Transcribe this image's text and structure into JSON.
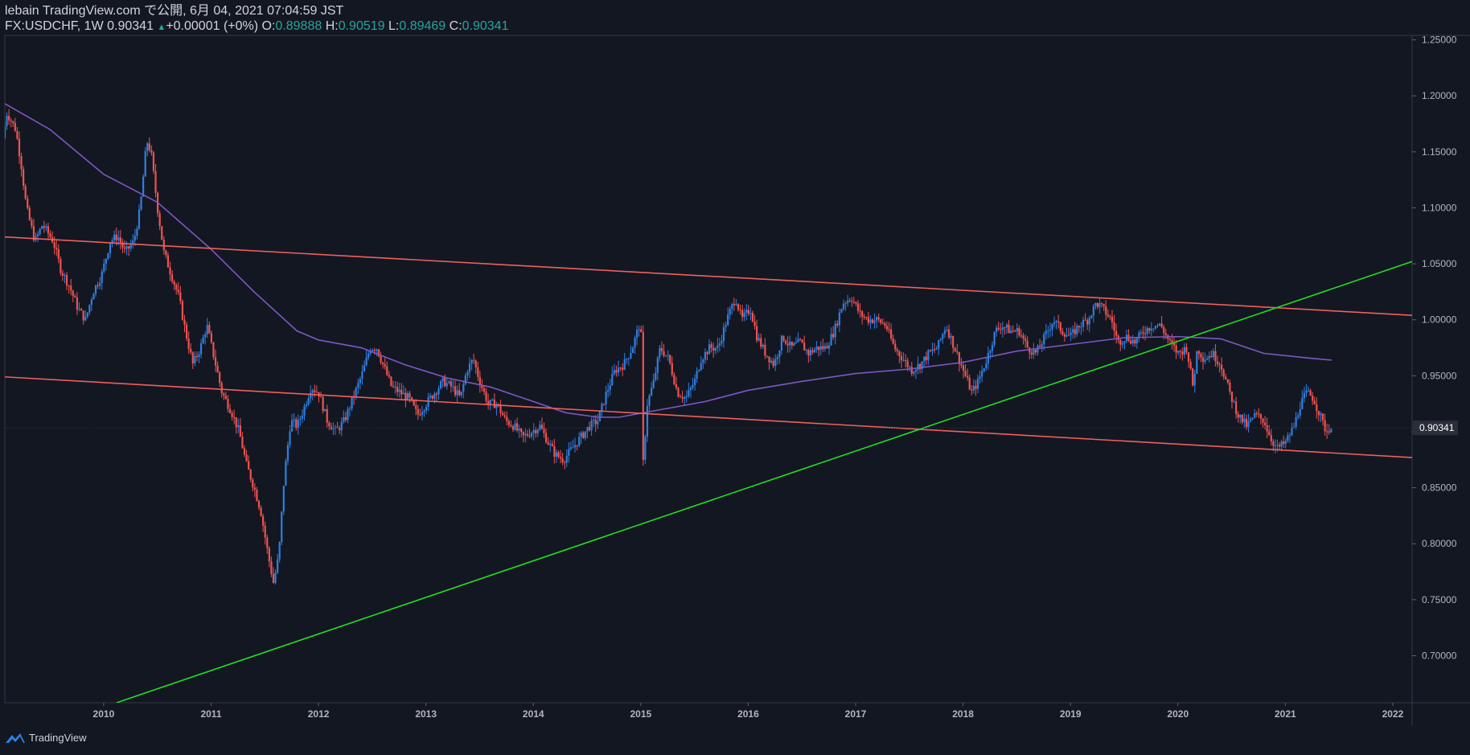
{
  "header": {
    "publish_line": "lebain TradingView.com で公開, 6月 04, 2021 07:04:59 JST",
    "symbol": "FX:USDCHF, 1W",
    "last": "0.90341",
    "change_arrow": "▲",
    "change": "+0.00001 (+0%)",
    "o_label": "O:",
    "o_value": "0.89888",
    "h_label": "H:",
    "h_value": "0.90519",
    "l_label": "L:",
    "l_value": "0.89469",
    "c_label": "C:",
    "c_value": "0.90341"
  },
  "footer": {
    "brand": "TradingView",
    "logo_icon": "tradingview-logo-icon"
  },
  "colors": {
    "background": "#131722",
    "up": "#2f7fe0",
    "down": "#ef5350",
    "channel": "#f0605a",
    "trendline": "#22dd22",
    "ma": "#7e57c2",
    "axis_text": "#b2b5be"
  },
  "chart_data": {
    "type": "candlestick",
    "symbol": "FX:USDCHF",
    "interval": "1W",
    "x_ticks": [
      "2010",
      "2011",
      "2012",
      "2013",
      "2014",
      "2015",
      "2016",
      "2017",
      "2018",
      "2019",
      "2020",
      "2021",
      "2022"
    ],
    "x_range": [
      2009.08,
      2022.18
    ],
    "y_ticks": [
      "1.25000",
      "1.20000",
      "1.15000",
      "1.10000",
      "1.05000",
      "1.00000",
      "0.95000",
      "0.90000",
      "0.85000",
      "0.80000",
      "0.75000",
      "0.70000"
    ],
    "y_range": [
      0.658,
      1.254
    ],
    "last_price_label": "0.90341",
    "last_price": 0.90341,
    "price_path": [
      [
        2009.08,
        1.162
      ],
      [
        2009.12,
        1.185
      ],
      [
        2009.2,
        1.17
      ],
      [
        2009.25,
        1.14
      ],
      [
        2009.3,
        1.1
      ],
      [
        2009.38,
        1.07
      ],
      [
        2009.45,
        1.085
      ],
      [
        2009.55,
        1.07
      ],
      [
        2009.62,
        1.045
      ],
      [
        2009.7,
        1.03
      ],
      [
        2009.78,
        1.01
      ],
      [
        2009.85,
        1.0
      ],
      [
        2009.92,
        1.025
      ],
      [
        2010.0,
        1.04
      ],
      [
        2010.08,
        1.07
      ],
      [
        2010.15,
        1.075
      ],
      [
        2010.22,
        1.06
      ],
      [
        2010.3,
        1.07
      ],
      [
        2010.36,
        1.1
      ],
      [
        2010.42,
        1.16
      ],
      [
        2010.46,
        1.15
      ],
      [
        2010.52,
        1.1
      ],
      [
        2010.58,
        1.06
      ],
      [
        2010.65,
        1.04
      ],
      [
        2010.72,
        1.02
      ],
      [
        2010.78,
        0.99
      ],
      [
        2010.85,
        0.96
      ],
      [
        2010.92,
        0.975
      ],
      [
        2010.98,
        0.995
      ],
      [
        2011.05,
        0.965
      ],
      [
        2011.12,
        0.935
      ],
      [
        2011.2,
        0.92
      ],
      [
        2011.28,
        0.9
      ],
      [
        2011.35,
        0.87
      ],
      [
        2011.42,
        0.85
      ],
      [
        2011.48,
        0.83
      ],
      [
        2011.55,
        0.79
      ],
      [
        2011.6,
        0.765
      ],
      [
        2011.65,
        0.79
      ],
      [
        2011.7,
        0.86
      ],
      [
        2011.76,
        0.91
      ],
      [
        2011.82,
        0.905
      ],
      [
        2011.88,
        0.92
      ],
      [
        2011.95,
        0.94
      ],
      [
        2012.02,
        0.935
      ],
      [
        2012.1,
        0.91
      ],
      [
        2012.18,
        0.9
      ],
      [
        2012.26,
        0.91
      ],
      [
        2012.34,
        0.93
      ],
      [
        2012.42,
        0.95
      ],
      [
        2012.5,
        0.975
      ],
      [
        2012.56,
        0.975
      ],
      [
        2012.62,
        0.96
      ],
      [
        2012.7,
        0.94
      ],
      [
        2012.78,
        0.935
      ],
      [
        2012.86,
        0.93
      ],
      [
        2012.94,
        0.915
      ],
      [
        2013.02,
        0.925
      ],
      [
        2013.1,
        0.935
      ],
      [
        2013.18,
        0.945
      ],
      [
        2013.26,
        0.94
      ],
      [
        2013.34,
        0.93
      ],
      [
        2013.4,
        0.955
      ],
      [
        2013.46,
        0.965
      ],
      [
        2013.52,
        0.945
      ],
      [
        2013.6,
        0.925
      ],
      [
        2013.68,
        0.925
      ],
      [
        2013.76,
        0.91
      ],
      [
        2013.84,
        0.905
      ],
      [
        2013.92,
        0.895
      ],
      [
        2014.0,
        0.9
      ],
      [
        2014.08,
        0.905
      ],
      [
        2014.16,
        0.89
      ],
      [
        2014.22,
        0.88
      ],
      [
        2014.3,
        0.875
      ],
      [
        2014.38,
        0.885
      ],
      [
        2014.46,
        0.895
      ],
      [
        2014.54,
        0.905
      ],
      [
        2014.62,
        0.91
      ],
      [
        2014.7,
        0.935
      ],
      [
        2014.78,
        0.955
      ],
      [
        2014.86,
        0.96
      ],
      [
        2014.94,
        0.975
      ],
      [
        2015.02,
        1.0
      ],
      [
        2015.04,
        0.87
      ],
      [
        2015.08,
        0.925
      ],
      [
        2015.14,
        0.945
      ],
      [
        2015.2,
        0.975
      ],
      [
        2015.28,
        0.965
      ],
      [
        2015.36,
        0.935
      ],
      [
        2015.44,
        0.93
      ],
      [
        2015.52,
        0.945
      ],
      [
        2015.58,
        0.965
      ],
      [
        2015.66,
        0.975
      ],
      [
        2015.74,
        0.975
      ],
      [
        2015.82,
        1.0
      ],
      [
        2015.9,
        1.02
      ],
      [
        2015.96,
        1.0
      ],
      [
        2016.04,
        1.01
      ],
      [
        2016.1,
        0.985
      ],
      [
        2016.18,
        0.97
      ],
      [
        2016.26,
        0.96
      ],
      [
        2016.34,
        0.985
      ],
      [
        2016.42,
        0.975
      ],
      [
        2016.5,
        0.98
      ],
      [
        2016.58,
        0.97
      ],
      [
        2016.66,
        0.975
      ],
      [
        2016.74,
        0.975
      ],
      [
        2016.82,
        0.99
      ],
      [
        2016.9,
        1.015
      ],
      [
        2016.98,
        1.02
      ],
      [
        2017.06,
        1.005
      ],
      [
        2017.14,
        1.0
      ],
      [
        2017.22,
        1.0
      ],
      [
        2017.3,
        0.995
      ],
      [
        2017.38,
        0.975
      ],
      [
        2017.46,
        0.965
      ],
      [
        2017.54,
        0.955
      ],
      [
        2017.62,
        0.96
      ],
      [
        2017.7,
        0.97
      ],
      [
        2017.78,
        0.975
      ],
      [
        2017.86,
        0.995
      ],
      [
        2017.94,
        0.975
      ],
      [
        2018.02,
        0.955
      ],
      [
        2018.1,
        0.935
      ],
      [
        2018.16,
        0.945
      ],
      [
        2018.24,
        0.965
      ],
      [
        2018.32,
        0.99
      ],
      [
        2018.38,
        0.995
      ],
      [
        2018.46,
        0.99
      ],
      [
        2018.54,
        0.99
      ],
      [
        2018.62,
        0.975
      ],
      [
        2018.7,
        0.97
      ],
      [
        2018.78,
        0.985
      ],
      [
        2018.86,
        1.0
      ],
      [
        2018.94,
        0.99
      ],
      [
        2019.02,
        0.985
      ],
      [
        2019.1,
        0.995
      ],
      [
        2019.18,
        1.0
      ],
      [
        2019.26,
        1.015
      ],
      [
        2019.32,
        1.01
      ],
      [
        2019.4,
        1.0
      ],
      [
        2019.46,
        0.98
      ],
      [
        2019.54,
        0.985
      ],
      [
        2019.62,
        0.98
      ],
      [
        2019.7,
        0.99
      ],
      [
        2019.78,
        0.995
      ],
      [
        2019.86,
        0.995
      ],
      [
        2019.94,
        0.98
      ],
      [
        2020.02,
        0.97
      ],
      [
        2020.1,
        0.975
      ],
      [
        2020.16,
        0.94
      ],
      [
        2020.2,
        0.975
      ],
      [
        2020.26,
        0.965
      ],
      [
        2020.34,
        0.97
      ],
      [
        2020.42,
        0.96
      ],
      [
        2020.5,
        0.935
      ],
      [
        2020.58,
        0.915
      ],
      [
        2020.66,
        0.905
      ],
      [
        2020.74,
        0.915
      ],
      [
        2020.82,
        0.91
      ],
      [
        2020.88,
        0.895
      ],
      [
        2020.94,
        0.885
      ],
      [
        2021.02,
        0.89
      ],
      [
        2021.1,
        0.905
      ],
      [
        2021.16,
        0.925
      ],
      [
        2021.22,
        0.935
      ],
      [
        2021.28,
        0.93
      ],
      [
        2021.34,
        0.915
      ],
      [
        2021.4,
        0.9
      ],
      [
        2021.43,
        0.90341
      ]
    ],
    "moving_average": [
      [
        2009.08,
        1.193
      ],
      [
        2009.5,
        1.17
      ],
      [
        2010.0,
        1.13
      ],
      [
        2010.5,
        1.105
      ],
      [
        2011.0,
        1.063
      ],
      [
        2011.4,
        1.025
      ],
      [
        2011.8,
        0.99
      ],
      [
        2012.0,
        0.982
      ],
      [
        2012.4,
        0.975
      ],
      [
        2012.8,
        0.96
      ],
      [
        2013.2,
        0.948
      ],
      [
        2013.6,
        0.94
      ],
      [
        2014.0,
        0.927
      ],
      [
        2014.3,
        0.917
      ],
      [
        2014.6,
        0.913
      ],
      [
        2014.8,
        0.913
      ],
      [
        2015.2,
        0.92
      ],
      [
        2015.6,
        0.927
      ],
      [
        2016.0,
        0.937
      ],
      [
        2016.5,
        0.945
      ],
      [
        2017.0,
        0.952
      ],
      [
        2017.5,
        0.956
      ],
      [
        2018.0,
        0.962
      ],
      [
        2018.5,
        0.972
      ],
      [
        2019.0,
        0.978
      ],
      [
        2019.5,
        0.984
      ],
      [
        2020.0,
        0.985
      ],
      [
        2020.4,
        0.983
      ],
      [
        2020.8,
        0.97
      ],
      [
        2021.2,
        0.966
      ],
      [
        2021.43,
        0.964
      ]
    ],
    "lines": [
      {
        "name": "upper-channel",
        "color": "channel",
        "from": [
          2009.08,
          1.074
        ],
        "to": [
          2022.18,
          1.004
        ]
      },
      {
        "name": "lower-channel",
        "color": "channel",
        "from": [
          2009.08,
          0.949
        ],
        "to": [
          2022.18,
          0.877
        ]
      },
      {
        "name": "rising-trendline",
        "color": "trendline",
        "from": [
          2010.12,
          0.658
        ],
        "to": [
          2022.18,
          1.052
        ]
      }
    ]
  }
}
